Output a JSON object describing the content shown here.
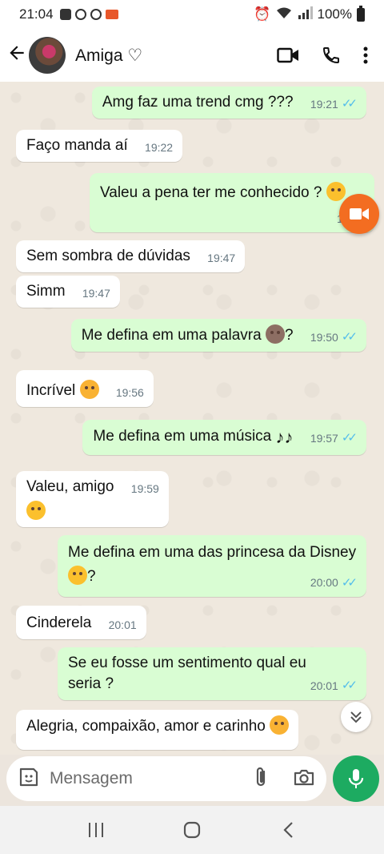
{
  "status_bar": {
    "time": "21:04",
    "battery": "100%"
  },
  "header": {
    "contact_name": "Amiga ♡"
  },
  "messages": [
    {
      "dir": "out",
      "text": "Amg faz uma trend cmg ???",
      "time": "19:21"
    },
    {
      "dir": "in",
      "text": "Faço manda aí",
      "time": "19:22"
    },
    {
      "dir": "out",
      "text": "Valeu a pena ter me conhecido ?",
      "emoji": "pleading-face",
      "time": "19:26"
    },
    {
      "dir": "in",
      "text": "Sem sombra de dúvidas",
      "time": "19:47"
    },
    {
      "dir": "in",
      "text": "Simm",
      "time": "19:47"
    },
    {
      "dir": "out",
      "text": "Me defina em uma palavra",
      "emoji": "see-no-evil-monkey",
      "suffix": "?",
      "time": "19:50"
    },
    {
      "dir": "in",
      "text": "Incrível",
      "emoji": "smiling-face-with-hearts",
      "time": "19:56"
    },
    {
      "dir": "out",
      "text": "Me defina em uma música",
      "suffix": "♪♪",
      "time": "19:57"
    },
    {
      "dir": "in",
      "text": "Valeu, amigo",
      "emoji": "pleading-face",
      "time": "19:59"
    },
    {
      "dir": "out",
      "text": "Me defina em uma das princesa da Disney",
      "emoji": "hugging-face",
      "suffix": "?",
      "time": "20:00"
    },
    {
      "dir": "in",
      "text": "Cinderela",
      "time": "20:01"
    },
    {
      "dir": "out",
      "text": "Se eu fosse um sentimento qual eu seria ?",
      "time": "20:01"
    },
    {
      "dir": "in",
      "text": "Alegria, compaixão, amor e carinho",
      "emoji": "smiling-face-with-hearts",
      "time": ""
    }
  ],
  "composer": {
    "placeholder": "Mensagem"
  },
  "colors": {
    "outgoing_bubble": "#d9fdd3",
    "incoming_bubble": "#ffffff",
    "read_ticks": "#53bdeb",
    "mic_button": "#1dab61",
    "floating_video": "#f36d21"
  }
}
